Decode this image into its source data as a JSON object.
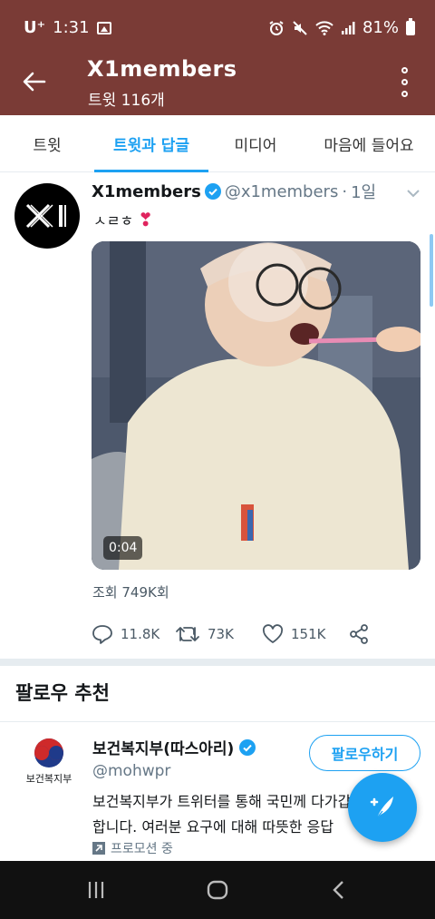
{
  "status_bar": {
    "carrier": "U⁺",
    "time": "1:31",
    "battery": "81%"
  },
  "header": {
    "title": "X1members",
    "subtitle": "트윗 116개"
  },
  "tabs": [
    {
      "label": "트윗",
      "active": false
    },
    {
      "label": "트윗과 답글",
      "active": true
    },
    {
      "label": "미디어",
      "active": false
    },
    {
      "label": "마음에 들어요",
      "active": false
    }
  ],
  "tweet": {
    "name": "X1members",
    "handle": "@x1members",
    "separator": "·",
    "time": "1일",
    "text": "ㅅㄹㅎ",
    "heart": "❣",
    "video_duration": "0:04",
    "views": "조회 749K회",
    "replies": "11.8K",
    "retweets": "73K",
    "likes": "151K"
  },
  "follow_suggestions": {
    "title": "팔로우 추천",
    "account": {
      "logo_text": "보건복지부",
      "name": "보건복지부(따스아리)",
      "handle": "@mohwpr",
      "follow_label": "팔로우하기",
      "bio_line1": "보건복지부가 트위터를 통해 국민께 다가갑니다",
      "bio_line2": "합니다. 여러분 요구에 대해 따뜻한 응답",
      "promoted": "프로모션 중"
    }
  },
  "colors": {
    "header_bg": "#7a3b36",
    "accent": "#1da1f2",
    "heart": "#e0245e",
    "verified": "#1da1f2"
  }
}
